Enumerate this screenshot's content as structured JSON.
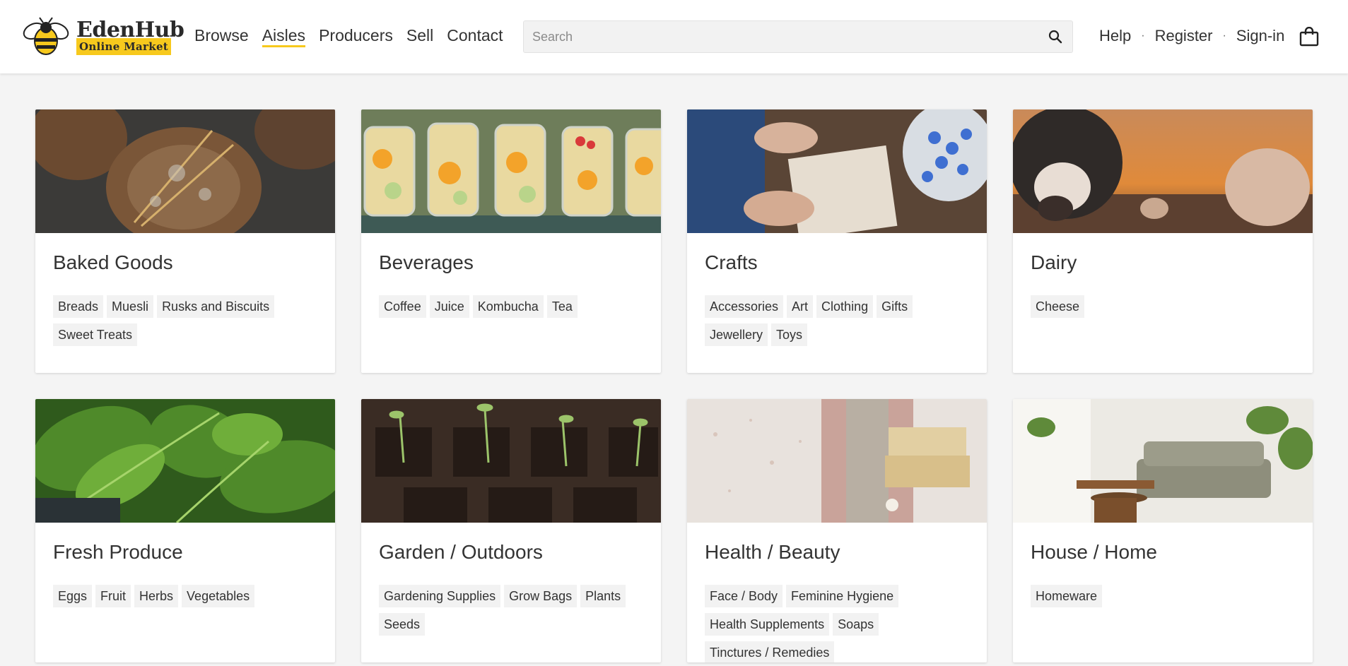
{
  "brand": {
    "name": "EdenHub",
    "tagline": "Online Market"
  },
  "nav": [
    {
      "label": "Browse",
      "active": false
    },
    {
      "label": "Aisles",
      "active": true
    },
    {
      "label": "Producers",
      "active": false
    },
    {
      "label": "Sell",
      "active": false
    },
    {
      "label": "Contact",
      "active": false
    }
  ],
  "search": {
    "placeholder": "Search",
    "value": ""
  },
  "user_links": {
    "help": "Help",
    "register": "Register",
    "signin": "Sign-in",
    "separator": "·"
  },
  "colors": {
    "accent": "#f7c91d",
    "tag_bg": "#f2f2f2",
    "page_bg": "#f4f4f4"
  },
  "aisles": [
    {
      "title": "Baked Goods",
      "tags": [
        "Breads",
        "Muesli",
        "Rusks and Biscuits",
        "Sweet Treats"
      ]
    },
    {
      "title": "Beverages",
      "tags": [
        "Coffee",
        "Juice",
        "Kombucha",
        "Tea"
      ]
    },
    {
      "title": "Crafts",
      "tags": [
        "Accessories",
        "Art",
        "Clothing",
        "Gifts",
        "Jewellery",
        "Toys"
      ]
    },
    {
      "title": "Dairy",
      "tags": [
        "Cheese"
      ]
    },
    {
      "title": "Fresh Produce",
      "tags": [
        "Eggs",
        "Fruit",
        "Herbs",
        "Vegetables"
      ]
    },
    {
      "title": "Garden / Outdoors",
      "tags": [
        "Gardening Supplies",
        "Grow Bags",
        "Plants",
        "Seeds"
      ]
    },
    {
      "title": "Health / Beauty",
      "tags": [
        "Face / Body",
        "Feminine Hygiene",
        "Health Supplements",
        "Soaps",
        "Tinctures / Remedies"
      ]
    },
    {
      "title": "House / Home",
      "tags": [
        "Homeware"
      ]
    }
  ]
}
